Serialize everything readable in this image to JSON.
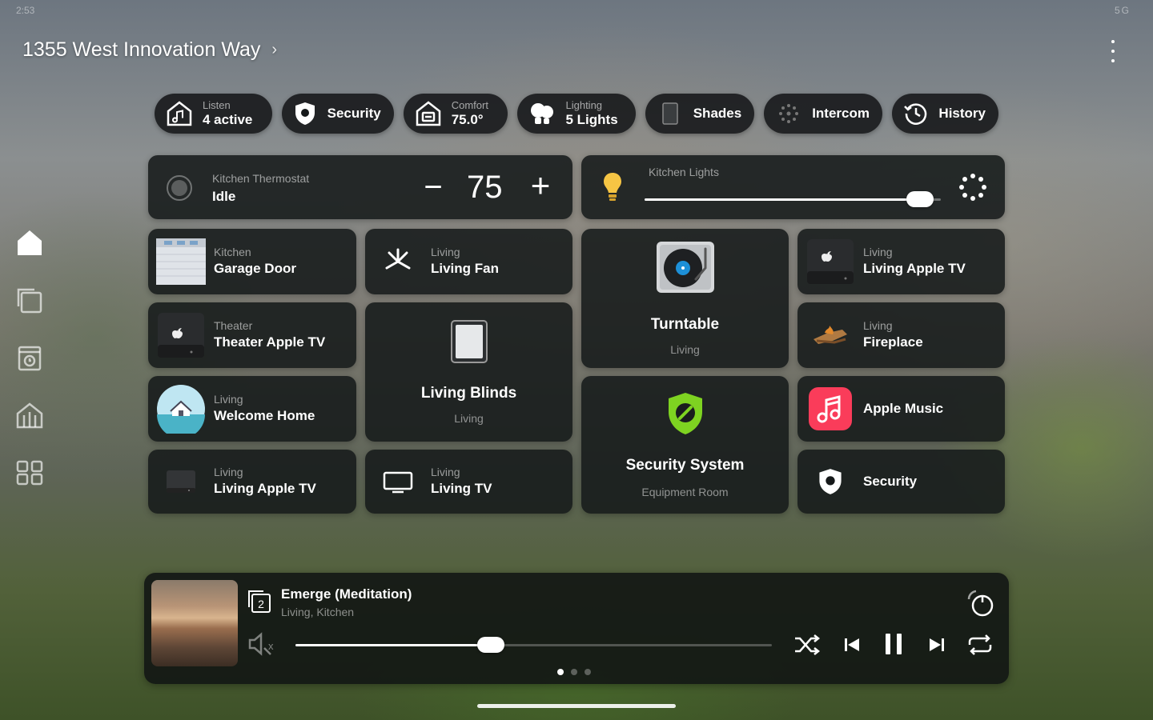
{
  "status": {
    "time": "2:53",
    "network": "5G"
  },
  "header": {
    "title": "1355 West Innovation Way"
  },
  "pills": [
    {
      "id": "listen",
      "label": "Listen",
      "value": "4 active",
      "icon": "speaker-icon"
    },
    {
      "id": "security",
      "label": "Security",
      "icon": "shield-icon"
    },
    {
      "id": "comfort",
      "label": "Comfort",
      "value": "75.0°",
      "icon": "thermostat-icon"
    },
    {
      "id": "lighting",
      "label": "Lighting",
      "value": "5 Lights",
      "icon": "lightbulbs-icon"
    },
    {
      "id": "shades",
      "label": "Shades",
      "icon": "shade-icon"
    },
    {
      "id": "intercom",
      "label": "Intercom",
      "icon": "intercom-icon"
    },
    {
      "id": "history",
      "label": "History",
      "icon": "history-icon"
    }
  ],
  "thermostat": {
    "name": "Kitchen Thermostat",
    "state": "Idle",
    "temp": "75",
    "minus": "−",
    "plus": "+"
  },
  "kitchen_lights": {
    "name": "Kitchen Lights",
    "level": 0.93
  },
  "tiles": {
    "garage_door": {
      "room": "Kitchen",
      "name": "Garage Door"
    },
    "living_fan": {
      "room": "Living",
      "name": "Living Fan"
    },
    "turntable": {
      "room": "Living",
      "name": "Turntable"
    },
    "living_apple_tv_1": {
      "room": "Living",
      "name": "Living Apple TV"
    },
    "theater_apple_tv": {
      "room": "Theater",
      "name": "Theater Apple TV"
    },
    "living_blinds": {
      "room": "Living",
      "name": "Living Blinds"
    },
    "fireplace": {
      "room": "Living",
      "name": "Fireplace"
    },
    "welcome_home": {
      "room": "Living",
      "name": "Welcome Home"
    },
    "security_system": {
      "room": "Equipment Room",
      "name": "Security System"
    },
    "apple_music": {
      "name": "Apple Music"
    },
    "living_apple_tv_2": {
      "room": "Living",
      "name": "Living Apple TV"
    },
    "living_tv": {
      "room": "Living",
      "name": "Living TV"
    },
    "security": {
      "name": "Security"
    }
  },
  "player": {
    "title": "Emerge (Meditation)",
    "rooms": "Living, Kitchen",
    "group_count": "2",
    "mute_mark": "x",
    "progress": 0.41,
    "page": 1,
    "pages": 3
  },
  "colors": {
    "accent_green": "#7ed321",
    "music_red": "#fa3c5a",
    "bulb_yellow": "#f6c544",
    "turntable_blue": "#1d90d8"
  }
}
